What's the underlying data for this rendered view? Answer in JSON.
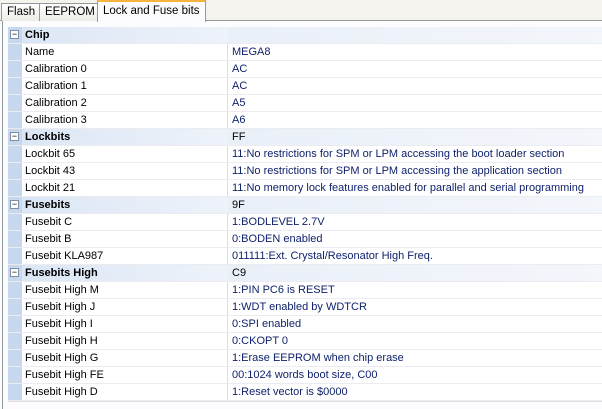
{
  "tabs": [
    {
      "label": "Flash"
    },
    {
      "label": "EEPROM"
    },
    {
      "label": "Lock and Fuse bits",
      "active": true
    }
  ],
  "categories": [
    {
      "name": "Chip",
      "value": "",
      "items": [
        {
          "name": "Name",
          "value": "MEGA8"
        },
        {
          "name": "Calibration 0",
          "value": "AC"
        },
        {
          "name": "Calibration 1",
          "value": "AC"
        },
        {
          "name": "Calibration 2",
          "value": "A5"
        },
        {
          "name": "Calibration 3",
          "value": "A6"
        }
      ]
    },
    {
      "name": "Lockbits",
      "value": "FF",
      "items": [
        {
          "name": "Lockbit 65",
          "value": "11:No restrictions for SPM or LPM accessing the boot loader section"
        },
        {
          "name": "Lockbit 43",
          "value": "11:No restrictions for SPM or LPM accessing the application section"
        },
        {
          "name": "Lockbit 21",
          "value": "11:No memory lock features enabled for parallel and serial programming"
        }
      ]
    },
    {
      "name": "Fusebits",
      "value": "9F",
      "items": [
        {
          "name": "Fusebit C",
          "value": "1:BODLEVEL 2.7V"
        },
        {
          "name": "Fusebit B",
          "value": "0:BODEN enabled"
        },
        {
          "name": "Fusebit KLA987",
          "value": "011111:Ext. Crystal/Resonator High Freq."
        }
      ]
    },
    {
      "name": "Fusebits High",
      "value": "C9",
      "items": [
        {
          "name": "Fusebit High M",
          "value": "1:PIN PC6 is RESET"
        },
        {
          "name": "Fusebit High J",
          "value": "1:WDT enabled by WDTCR"
        },
        {
          "name": "Fusebit High I",
          "value": "0:SPI enabled"
        },
        {
          "name": "Fusebit High H",
          "value": "0:CKOPT 0"
        },
        {
          "name": "Fusebit High G",
          "value": "1:Erase EEPROM when chip erase"
        },
        {
          "name": "Fusebit High FE",
          "value": "00:1024 words boot size, C00"
        },
        {
          "name": "Fusebit High D",
          "value": "1:Reset vector is $0000"
        }
      ]
    }
  ],
  "collapse_glyph": "−"
}
